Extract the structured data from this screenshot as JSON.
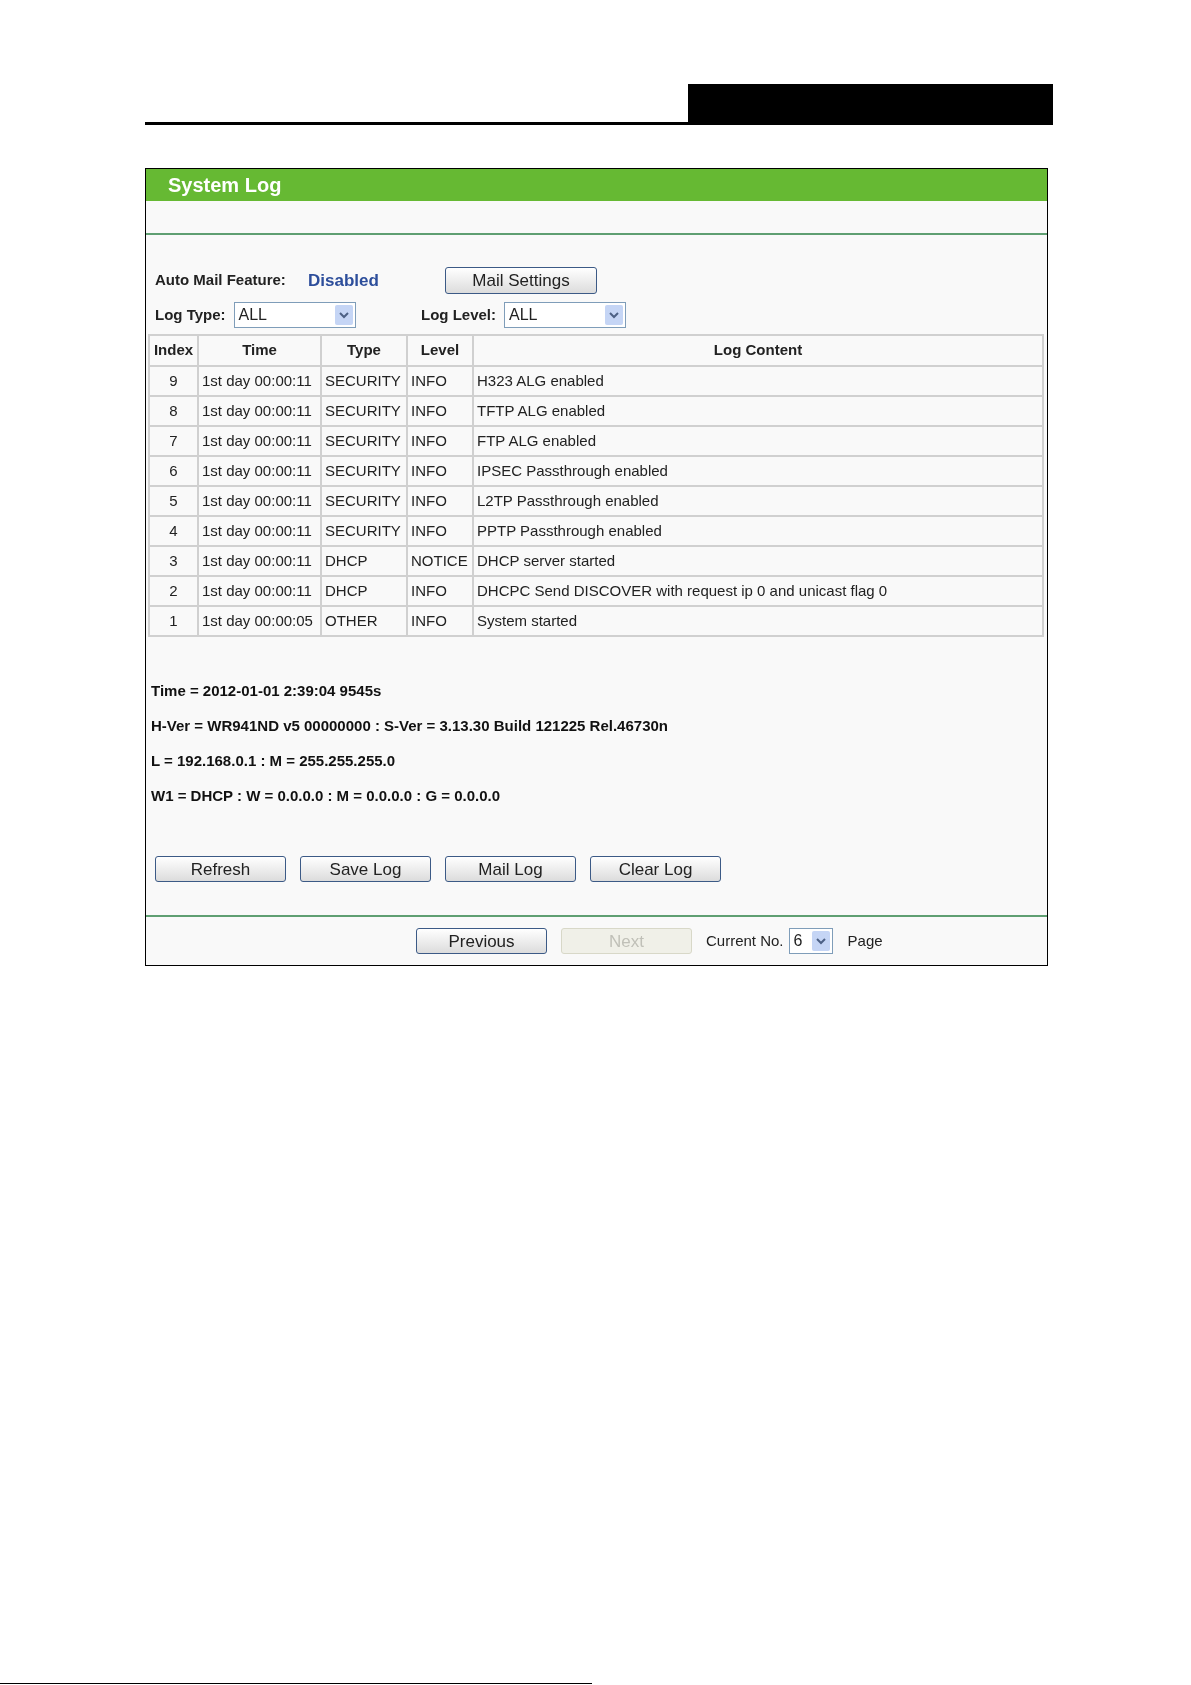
{
  "panel": {
    "title": "System Log"
  },
  "auto_mail": {
    "label": "Auto Mail Feature:",
    "value": "Disabled",
    "button": "Mail Settings"
  },
  "filters": [
    {
      "label": "Log Type:",
      "value": "ALL"
    },
    {
      "label": "Log Level:",
      "value": "ALL"
    }
  ],
  "table": {
    "columns": [
      "Index",
      "Time",
      "Type",
      "Level",
      "Log Content"
    ],
    "rows": [
      [
        "9",
        "1st day 00:00:11",
        "SECURITY",
        "INFO",
        "H323 ALG enabled"
      ],
      [
        "8",
        "1st day 00:00:11",
        "SECURITY",
        "INFO",
        "TFTP ALG enabled"
      ],
      [
        "7",
        "1st day 00:00:11",
        "SECURITY",
        "INFO",
        "FTP ALG enabled"
      ],
      [
        "6",
        "1st day 00:00:11",
        "SECURITY",
        "INFO",
        "IPSEC Passthrough enabled"
      ],
      [
        "5",
        "1st day 00:00:11",
        "SECURITY",
        "INFO",
        "L2TP Passthrough enabled"
      ],
      [
        "4",
        "1st day 00:00:11",
        "SECURITY",
        "INFO",
        "PPTP Passthrough enabled"
      ],
      [
        "3",
        "1st day 00:00:11",
        "DHCP",
        "NOTICE",
        "DHCP server started"
      ],
      [
        "2",
        "1st day 00:00:11",
        "DHCP",
        "INFO",
        "DHCPC Send DISCOVER with request ip 0 and unicast flag 0"
      ],
      [
        "1",
        "1st day 00:00:05",
        "OTHER",
        "INFO",
        "System started"
      ]
    ]
  },
  "info_lines": [
    "Time = 2012-01-01 2:39:04 9545s",
    "H-Ver = WR941ND v5 00000000 : S-Ver = 3.13.30 Build 121225 Rel.46730n",
    "L = 192.168.0.1 : M = 255.255.255.0",
    "W1 = DHCP : W = 0.0.0.0 : M = 0.0.0.0 : G = 0.0.0.0"
  ],
  "actions": [
    {
      "label": "Refresh"
    },
    {
      "label": "Save Log"
    },
    {
      "label": "Mail Log"
    },
    {
      "label": "Clear Log"
    }
  ],
  "pager": {
    "buttons": [
      {
        "label": "Previous",
        "disabled": false
      },
      {
        "label": "Next",
        "disabled": true
      }
    ],
    "current_label": "Current No.",
    "current_value": "6",
    "page_label": "Page"
  }
}
